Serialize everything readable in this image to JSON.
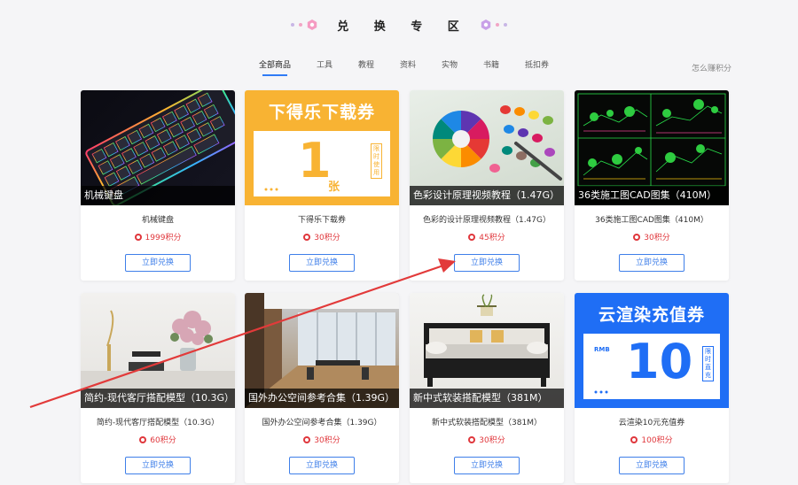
{
  "header": {
    "title": "兑 换 专 区"
  },
  "tabs": [
    {
      "label": "全部商品",
      "active": true
    },
    {
      "label": "工具"
    },
    {
      "label": "教程"
    },
    {
      "label": "资料"
    },
    {
      "label": "实物"
    },
    {
      "label": "书籍"
    },
    {
      "label": "抵扣券"
    }
  ],
  "earn_link": "怎么赚积分",
  "colors": {
    "accent": "#2f7bf5",
    "price": "#e0373c",
    "coupon_orange": "#f8b333",
    "coupon_blue": "#1f6ef5",
    "arrow": "#e23a3a"
  },
  "products": [
    {
      "caption": "机械键盘",
      "name": "机械键盘",
      "points": "1999积分",
      "button": "立即兑换"
    },
    {
      "caption": "",
      "name": "下得乐下载券",
      "points": "30积分",
      "button": "立即兑换",
      "coupon": {
        "title": "下得乐下载券",
        "big": "1",
        "unit": "张",
        "tag": "限时使用"
      }
    },
    {
      "caption": "色彩设计原理视频教程（1.47G）",
      "name": "色彩的设计原理视频教程（1.47G）",
      "points": "45积分",
      "button": "立即兑换"
    },
    {
      "caption": "36类施工图CAD图集（410M）",
      "name": "36类施工图CAD图集（410M）",
      "points": "30积分",
      "button": "立即兑换"
    },
    {
      "caption": "简约-现代客厅搭配模型（10.3G）",
      "name": "简约-现代客厅搭配模型（10.3G）",
      "points": "60积分",
      "button": "立即兑换"
    },
    {
      "caption": "国外办公空间参考合集（1.39G）",
      "name": "国外办公空间参考合集（1.39G）",
      "points": "30积分",
      "button": "立即兑换"
    },
    {
      "caption": "新中式软装搭配模型（381M）",
      "name": "新中式软装搭配模型（381M）",
      "points": "30积分",
      "button": "立即兑换"
    },
    {
      "caption": "",
      "name": "云渲染10元充值券",
      "points": "100积分",
      "button": "立即兑换",
      "coupon": {
        "title": "云渲染充值券",
        "big": "10",
        "unit": "RMB",
        "tag": "限时直充"
      }
    }
  ]
}
